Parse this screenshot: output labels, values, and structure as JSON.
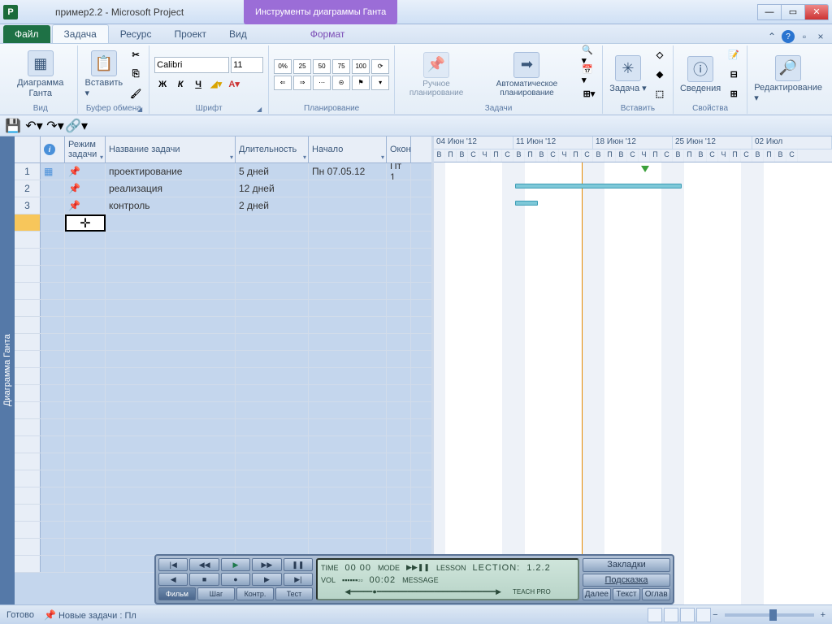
{
  "titlebar": {
    "app_icon": "P",
    "title": "пример2.2  -  Microsoft Project",
    "context_tools": "Инструменты диаграммы Ганта"
  },
  "tabs": {
    "file": "Файл",
    "task": "Задача",
    "resource": "Ресурс",
    "project": "Проект",
    "view": "Вид",
    "format": "Формат"
  },
  "ribbon": {
    "view_group": "Вид",
    "gantt_btn": "Диаграмма Ганта",
    "clipboard_group": "Буфер обмена",
    "paste_btn": "Вставить",
    "font_group": "Шрифт",
    "font_name": "Calibri",
    "font_size": "11",
    "planning_group": "Планирование",
    "tasks_group": "Задачи",
    "manual_label": "Ручное планирование",
    "auto_label": "Автоматическое планирование",
    "insert_group": "Вставить",
    "task_btn": "Задача",
    "properties_group": "Свойства",
    "info_btn": "Сведения",
    "editing_group": "Редактирование"
  },
  "side_label": "Диаграмма Ганта",
  "columns": {
    "mode": "Режим задачи",
    "name": "Название задачи",
    "duration": "Длительность",
    "start": "Начало",
    "end": "Окон"
  },
  "tasks": [
    {
      "n": "1",
      "name": "проектирование",
      "dur": "5 дней",
      "start": "Пн 07.05.12",
      "end": "Пт 1"
    },
    {
      "n": "2",
      "name": "реализация",
      "dur": "12 дней",
      "start": "",
      "end": ""
    },
    {
      "n": "3",
      "name": "контроль",
      "dur": "2 дней",
      "start": "",
      "end": ""
    }
  ],
  "timeline": {
    "weeks": [
      "04 Июн '12",
      "11 Июн '12",
      "18 Июн '12",
      "25 Июн '12",
      "02 Июл"
    ],
    "days": [
      "В",
      "П",
      "В",
      "С",
      "Ч",
      "П",
      "С",
      "В",
      "П",
      "В",
      "С",
      "Ч",
      "П",
      "С",
      "В",
      "П",
      "В",
      "С",
      "Ч",
      "П",
      "С",
      "В",
      "П",
      "В",
      "С",
      "Ч",
      "П",
      "С",
      "В",
      "П",
      "В",
      "С"
    ]
  },
  "statusbar": {
    "ready": "Готово",
    "new_tasks": "Новые задачи : Пл"
  },
  "player": {
    "tabs": [
      "Фильм",
      "Шаг",
      "Контр.",
      "Тест"
    ],
    "lcd_time_label": "TIME",
    "lcd_time": "00 00",
    "lcd_mode_label": "MODE",
    "lcd_lesson_label": "LESSON",
    "lcd_lection_label": "LECTION:",
    "lcd_lection": "1.2.2",
    "lcd_vol_label": "VOL",
    "lcd_counter": "00:02",
    "lcd_message_label": "MESSAGE",
    "lcd_brand": "TEACH PRO",
    "side1": "Закладки",
    "side2": "Подсказка",
    "nav": [
      "Далее",
      "Текст",
      "Оглав"
    ]
  },
  "colors": {
    "accent": "#1e7145",
    "context": "#9b6dd7"
  }
}
